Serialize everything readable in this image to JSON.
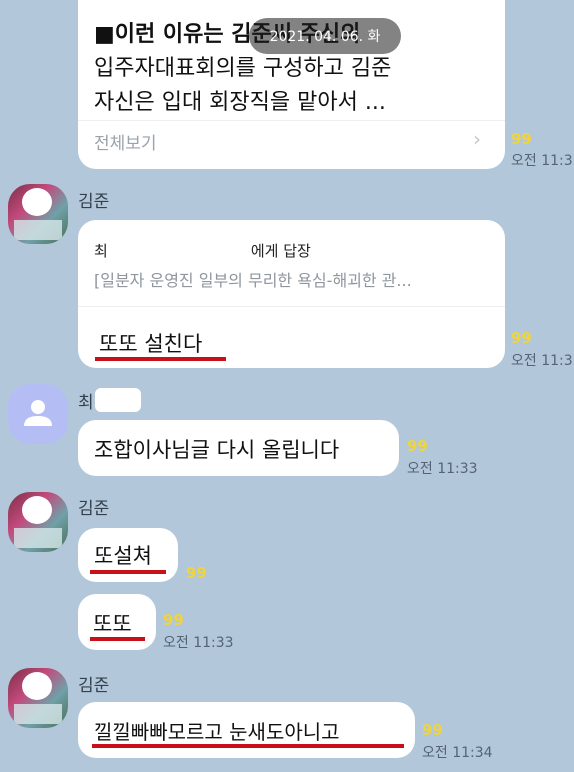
{
  "date_badge": "2021. 04. 06. 화",
  "top_card": {
    "line1": "■이런 이유는 김준씨 주신의",
    "line2": "입주자대표회의를 구성하고 김준",
    "line3": "자신은 입대 회장직을 맡아서 ...",
    "see_all": "전체보기",
    "unread": "99",
    "time": "오전 11:3"
  },
  "messages": [
    {
      "sender": "김준",
      "reply_to": "최                              에게 답장",
      "quote": "[일분자 운영진 일부의 무리한 욕심-해괴한  관...",
      "text": "또또 설친다",
      "unread": "99",
      "time": "오전 11:3"
    },
    {
      "sender": "최",
      "text": "조합이사님글 다시 올립니다",
      "unread": "99",
      "time": "오전 11:33"
    },
    {
      "sender": "김준",
      "text1": "또설쳐",
      "unread1": "99",
      "text2": "또또",
      "unread2": "99",
      "time2": "오전 11:33"
    },
    {
      "sender": "김준",
      "text": "낄낄빠빠모르고 눈새도아니고",
      "unread": "99",
      "time": "오전 11:34"
    }
  ],
  "colors": {
    "background": "#b2c7d9",
    "bubble": "#ffffff",
    "unread": "#f0d43b",
    "underline": "#c8101a"
  }
}
